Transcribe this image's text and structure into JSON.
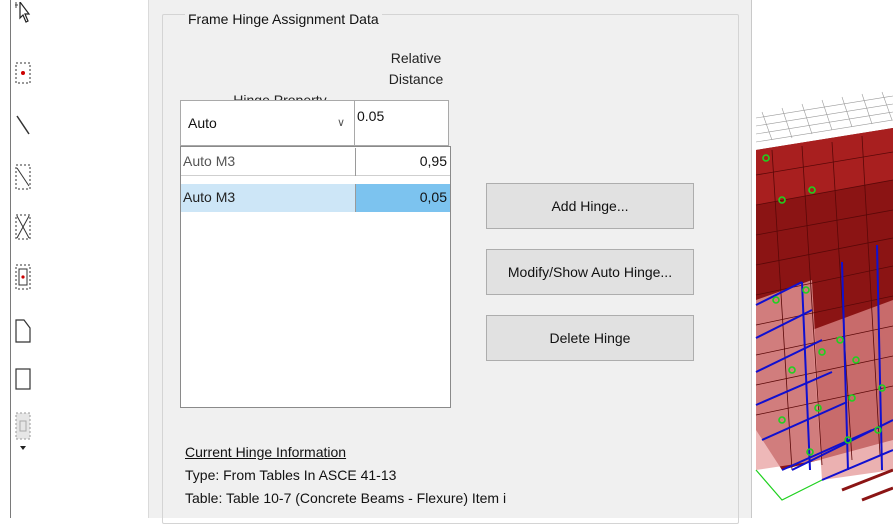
{
  "toolbar": {
    "tools": [
      "pointer-icon",
      "point-select-icon",
      "line-icon",
      "window-select-icon",
      "crossing-select-icon",
      "frame-select-icon",
      "area-icon",
      "rectangle-icon",
      "more-tools-icon"
    ]
  },
  "dialog": {
    "group_title": "Frame Hinge Assignment Data",
    "columns": {
      "hinge_property": "Hinge Property",
      "relative_distance_line1": "Relative",
      "relative_distance_line2": "Distance"
    },
    "hinge_property_select": {
      "value": "Auto"
    },
    "relative_distance_input": {
      "value": "0.05"
    },
    "hinges": [
      {
        "property": "Auto  M3",
        "distance": "0,95"
      },
      {
        "property": "Auto  M3",
        "distance": "0,05",
        "selected": true
      }
    ],
    "buttons": {
      "add": "Add Hinge...",
      "modify": "Modify/Show Auto Hinge...",
      "delete": "Delete Hinge"
    },
    "current_info": {
      "heading": "Current Hinge Information",
      "type": "Type:  From Tables In ASCE 41-13",
      "table": "Table:  Table 10-7 (Concrete Beams - Flexure) Item i"
    }
  },
  "colors": {
    "selection_row": "#cde6f7",
    "selection_cell": "#7cc3ef",
    "model_fill": "#8b1414",
    "model_blue": "#1010d0",
    "model_green": "#1fd11f"
  }
}
